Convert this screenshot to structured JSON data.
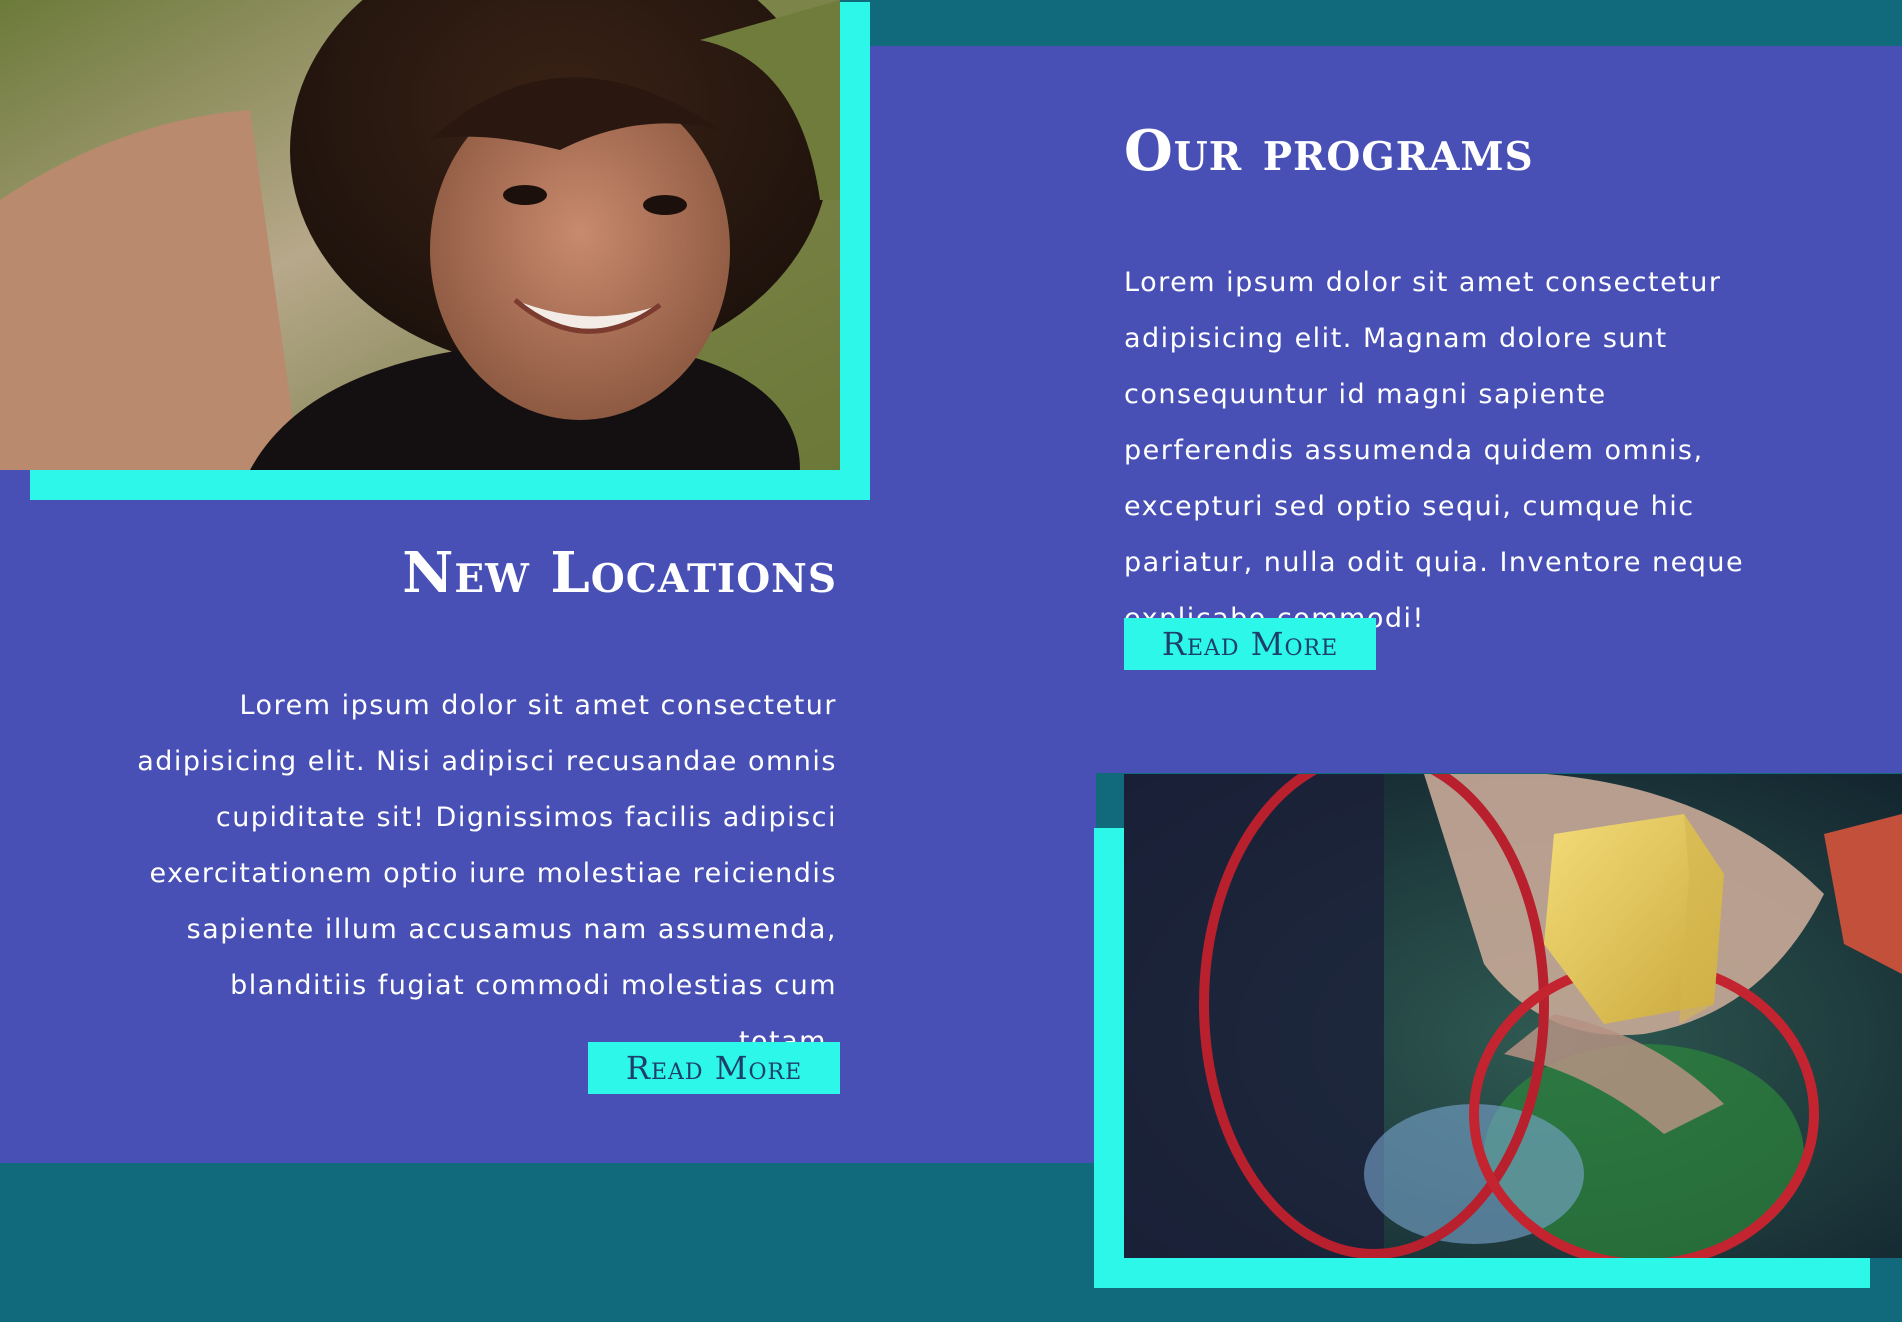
{
  "new_locations": {
    "title": "New Locations",
    "body": "Lorem ipsum dolor sit amet consectetur adipisicing elit. Nisi adipisci recusandae omnis cupiditate sit! Dignissimos facilis adipisci exercitationem optio iure molestiae reiciendis sapiente illum accusamus nam assumenda, blanditiis fugiat commodi molestias cum totam.",
    "button_label": "Read More"
  },
  "our_programs": {
    "title": "Our programs",
    "body": "Lorem ipsum dolor sit amet consectetur adipisicing elit. Magnam dolore sunt consequuntur id magni sapiente perferendis assumenda quidem omnis, excepturi sed optio sequi, cumque hic pariatur, nulla odit quia. Inventore neque explicabo commodi!",
    "button_label": "Read More"
  },
  "colors": {
    "background": "#116a7b",
    "panel": "#4850b6",
    "accent": "#2cf7e8",
    "button_text": "#1e3e6c",
    "text": "#ffffff"
  }
}
